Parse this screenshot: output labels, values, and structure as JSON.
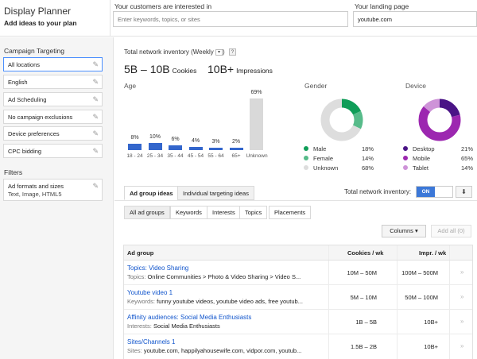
{
  "header": {
    "app_title": "Display Planner",
    "app_subtitle": "Add ideas to your plan",
    "keywords_label": "Your customers are interested in",
    "keywords_placeholder": "Enter keywords, topics, or sites",
    "landing_label": "Your landing page",
    "landing_value": "youtube.com"
  },
  "sidebar": {
    "campaign_heading": "Campaign Targeting",
    "items": [
      {
        "label": "All locations"
      },
      {
        "label": "English"
      },
      {
        "label": "Ad Scheduling"
      },
      {
        "label": "No campaign exclusions"
      },
      {
        "label": "Device preferences"
      },
      {
        "label": "CPC bidding"
      }
    ],
    "filters_heading": "Filters",
    "filter_item": {
      "label": "Ad formats and sizes",
      "sub": "Text, Image, HTML5"
    }
  },
  "inventory": {
    "label": "Total network inventory",
    "period": "(Weekly",
    "period_close": ")",
    "dd_glyph": "▾",
    "help": "?",
    "cookies_value": "5B – 10B",
    "cookies_unit": "Cookies",
    "impressions_value": "10B+",
    "impressions_unit": "Impressions"
  },
  "age": {
    "title": "Age",
    "chart_data": {
      "type": "bar",
      "categories": [
        "18 - 24",
        "25 - 34",
        "35 - 44",
        "45 - 54",
        "55 - 64",
        "65+",
        "Unknown"
      ],
      "values": [
        8,
        10,
        6,
        4,
        3,
        2,
        69
      ],
      "labels": [
        "8%",
        "10%",
        "6%",
        "4%",
        "3%",
        "2%",
        "69%"
      ],
      "colors": [
        "#3366cc",
        "#3366cc",
        "#3366cc",
        "#3366cc",
        "#3366cc",
        "#3366cc",
        "#d9d9d9"
      ]
    }
  },
  "gender": {
    "title": "Gender",
    "chart_data": {
      "type": "pie",
      "categories": [
        "Male",
        "Female",
        "Unknown"
      ],
      "values": [
        18,
        14,
        68
      ],
      "labels": [
        "18%",
        "14%",
        "68%"
      ],
      "colors": [
        "#0f9d58",
        "#57bb8a",
        "#dddddd"
      ]
    }
  },
  "device": {
    "title": "Device",
    "chart_data": {
      "type": "pie",
      "categories": [
        "Desktop",
        "Mobile",
        "Tablet"
      ],
      "values": [
        21,
        65,
        14
      ],
      "labels": [
        "21%",
        "65%",
        "14%"
      ],
      "colors": [
        "#4a1486",
        "#9c27b0",
        "#ce93d8"
      ]
    }
  },
  "tabs": [
    "Ad group ideas",
    "Individual targeting ideas"
  ],
  "toggle": {
    "label": "Total network inventory:",
    "on": "ON",
    "download": "⬇"
  },
  "subtabs": [
    "All ad groups",
    "Keywords",
    "Interests",
    "Topics",
    "Placements"
  ],
  "buttons": {
    "columns": "Columns ▾",
    "add_all": "Add all (0)"
  },
  "table": {
    "headers": {
      "ad_group": "Ad group",
      "cookies": "Cookies / wk",
      "impr": "Impr. / wk"
    },
    "arrow": "»",
    "rows": [
      {
        "title": "Topics: Video Sharing",
        "prefix": "Topics:",
        "sub": "Online Communities > Photo & Video Sharing > Video S...",
        "cookies": "10M – 50M",
        "impr": "100M – 500M"
      },
      {
        "title": "Youtube video 1",
        "prefix": "Keywords:",
        "sub": "funny youtube videos, youtube video ads, free youtub...",
        "cookies": "5M – 10M",
        "impr": "50M – 100M"
      },
      {
        "title": "Affinity audiences: Social Media Enthusiasts",
        "prefix": "Interests:",
        "sub": "Social Media Enthusiasts",
        "cookies": "1B – 5B",
        "impr": "10B+"
      },
      {
        "title": "Sites/Channels 1",
        "prefix": "Sites:",
        "sub": "youtube.com, happilyahousewife.com, vidpor.com, youtub...",
        "cookies": "1.5B – 2B",
        "impr": "10B+"
      }
    ]
  }
}
